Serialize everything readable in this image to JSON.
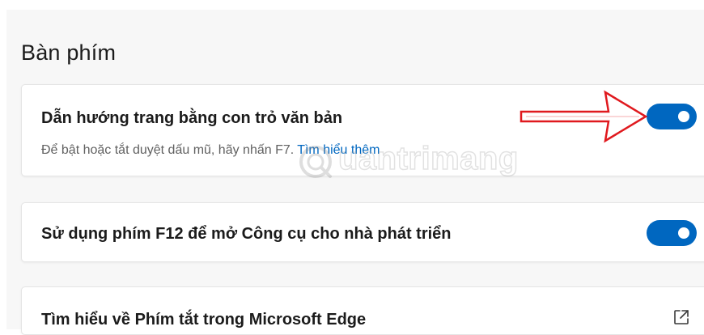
{
  "section": {
    "title": "Bàn phím"
  },
  "settings": [
    {
      "title": "Dẫn hướng trang bằng con trỏ văn bản",
      "description": "Để bật hoặc tắt duyệt dấu mũ, hãy nhấn F7.",
      "link": "Tìm hiểu thêm",
      "toggle_on": true
    },
    {
      "title": "Sử dụng phím F12 để mở Công cụ cho nhà phát triển",
      "toggle_on": true
    },
    {
      "title": "Tìm hiểu về Phím tắt trong Microsoft Edge",
      "icon": "external-link-icon"
    }
  ],
  "colors": {
    "accent": "#0067c0",
    "annotation_arrow": "#e0191e",
    "panel_bg": "#f7f7f7"
  },
  "watermark": {
    "text": "uantrimang",
    "icon": "quantrimang-logo"
  }
}
